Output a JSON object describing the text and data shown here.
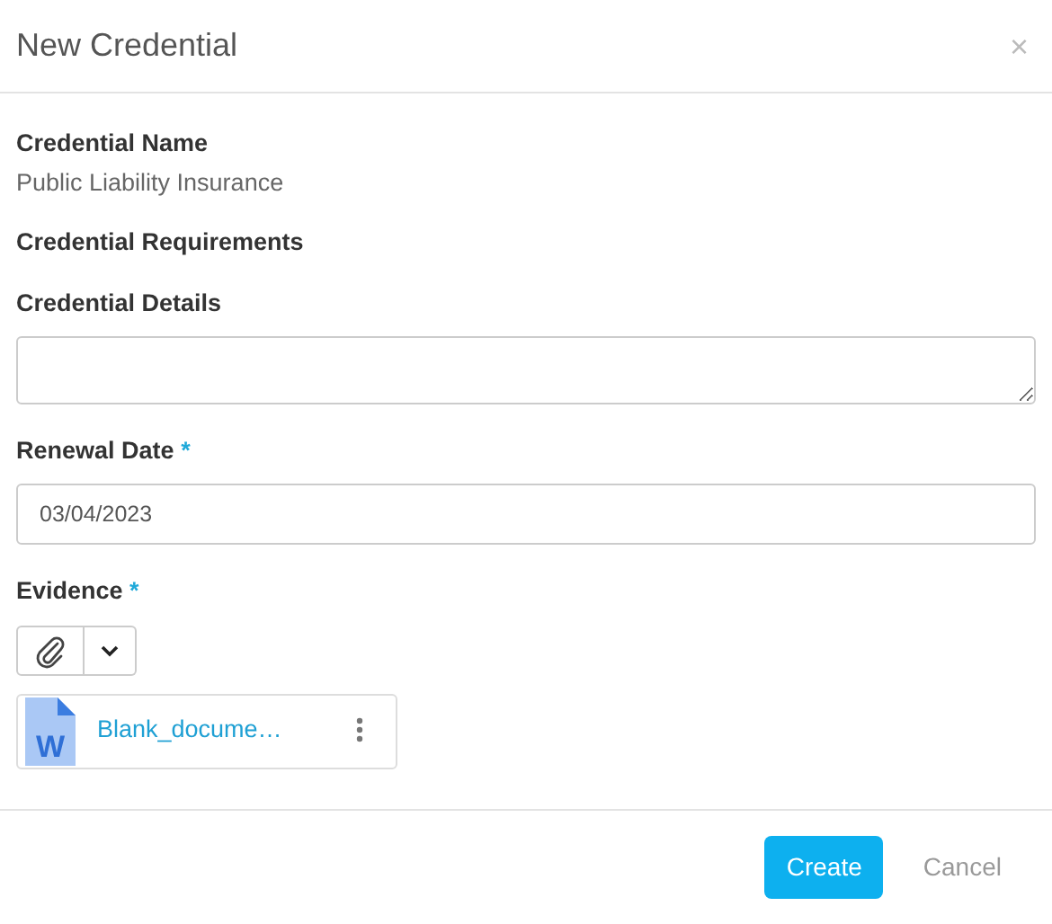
{
  "dialog": {
    "title": "New Credential",
    "close": "×"
  },
  "fields": [
    {
      "kind": "static",
      "label": "Credential Name",
      "value": "Public Liability Insurance"
    },
    {
      "kind": "heading",
      "label": "Credential Requirements"
    },
    {
      "kind": "textarea",
      "label": "Credential Details"
    },
    {
      "kind": "input",
      "label": "Renewal Date",
      "required_mark": "*",
      "value": "03/04/2023"
    },
    {
      "kind": "evidence",
      "label": "Evidence",
      "required_mark": "*",
      "files": [
        {
          "name": "Blank_docume…",
          "icon_letter": "W"
        }
      ]
    }
  ],
  "buttons": [
    {
      "label": "Create",
      "kind": "primary"
    },
    {
      "label": "Cancel",
      "kind": "link"
    }
  ]
}
